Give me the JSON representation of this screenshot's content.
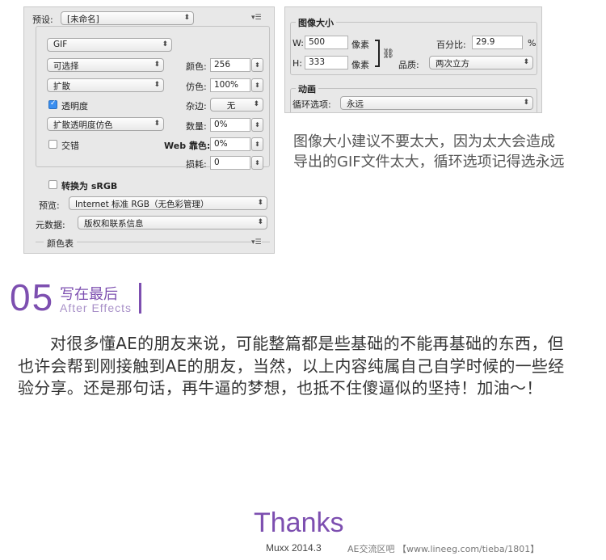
{
  "left_panel": {
    "preset_label": "预设:",
    "preset_value": "[未命名]",
    "format_value": "GIF",
    "reduction_value": "可选择",
    "colors_label": "颜色:",
    "colors_value": "256",
    "dither_method_value": "扩散",
    "dither_label": "仿色:",
    "dither_value": "100%",
    "transparency_label": "透明度",
    "transparency_checked": true,
    "matte_label": "杂边:",
    "matte_value": "无",
    "trans_dither_value": "扩散透明度仿色",
    "amount_label": "数量:",
    "amount_value": "0%",
    "interlaced_label": "交错",
    "interlaced_checked": false,
    "web_snap_label": "Web 靠色:",
    "web_snap_value": "0%",
    "lossy_label": "损耗:",
    "lossy_value": "0",
    "convert_srgb_label": "转换为 sRGB",
    "preview_label": "预览:",
    "preview_value": "Internet 标准 RGB（无色彩管理）",
    "metadata_label": "元数据:",
    "metadata_value": "版权和联系信息",
    "color_table_label": "颜色表"
  },
  "right_panel": {
    "image_size_title": "图像大小",
    "w_label": "W:",
    "w_value": "500",
    "w_unit": "像素",
    "h_label": "H:",
    "h_value": "333",
    "h_unit": "像素",
    "percent_label": "百分比:",
    "percent_value": "29.9",
    "percent_sign": "%",
    "quality_label": "品质:",
    "quality_value": "两次立方",
    "animation_title": "动画",
    "loop_label": "循环选项:",
    "loop_value": "永远"
  },
  "note_text": "图像大小建议不要太大，因为太大会造成导出的GIF文件太大，循环选项记得选永远",
  "section": {
    "number": "05",
    "title": "写在最后",
    "subtitle": "After Effects"
  },
  "body_text": "对很多懂AE的朋友来说，可能整篇都是些基础的不能再基础的东西，但也许会帮到刚接触到AE的朋友，当然，以上内容纯属自己自学时候的一些经验分享。还是那句话，再牛逼的梦想，也抵不住傻逼似的坚持！加油～！",
  "footer": {
    "thanks": "Thanks",
    "author_date": "Muxx 2014.3",
    "watermark": "AE交流区吧 【www.lineeg.com/tieba/1801】"
  },
  "colors": {
    "accent": "#7d4fb0",
    "panel_bg": "#e8e8e8"
  }
}
